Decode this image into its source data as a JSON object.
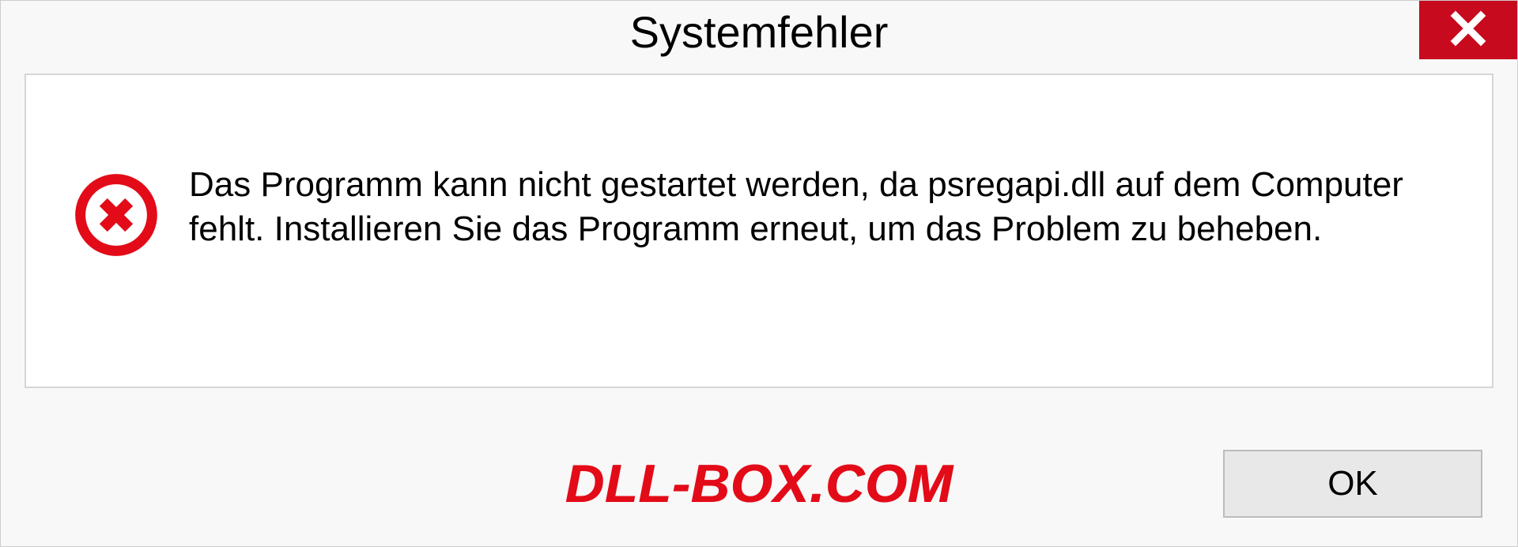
{
  "dialog": {
    "title": "Systemfehler",
    "message": "Das Programm kann nicht gestartet werden, da psregapi.dll auf dem Computer fehlt. Installieren Sie das Programm erneut, um das Problem zu beheben.",
    "ok_label": "OK"
  },
  "watermark": {
    "text": "DLL-BOX.COM"
  }
}
